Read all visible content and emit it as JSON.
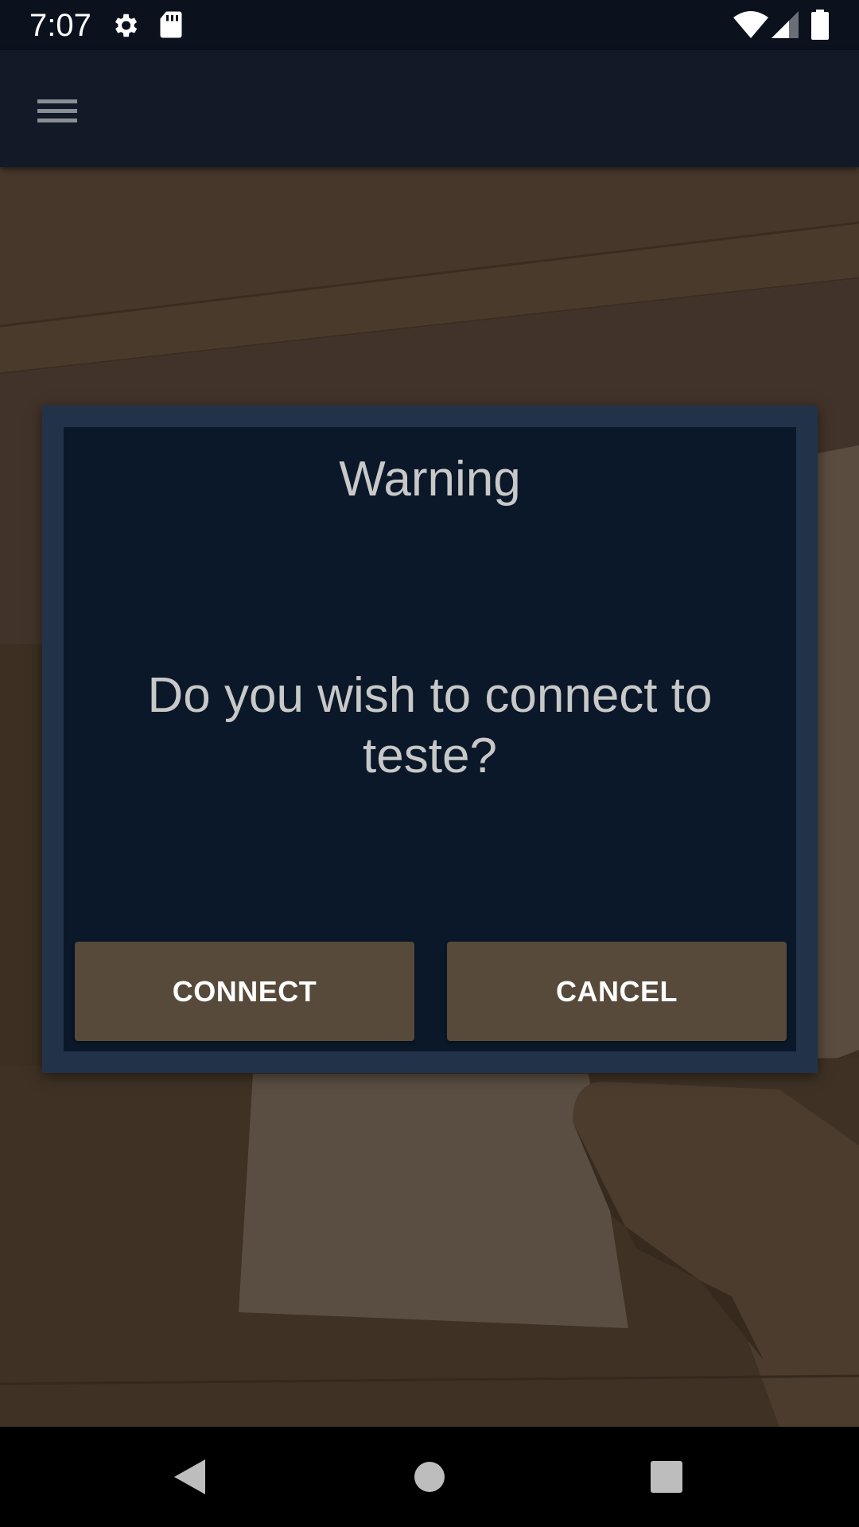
{
  "status_bar": {
    "time": "7:07",
    "icons": [
      "settings-icon",
      "sd-card-icon",
      "wifi-icon",
      "signal-icon",
      "battery-icon"
    ]
  },
  "app_bar": {
    "menu_icon": "hamburger-menu-icon"
  },
  "dialog": {
    "title": "Warning",
    "message": "Do you wish to connect to teste?",
    "connect_label": "CONNECT",
    "cancel_label": "CANCEL"
  },
  "nav_bar": {
    "icons": [
      "back-icon",
      "home-icon",
      "recents-icon"
    ]
  },
  "colors": {
    "status_bar_bg": "#0b121d",
    "app_bar_bg": "#121a27",
    "dialog_frame": "#223248",
    "dialog_bg": "#0a1829",
    "button_bg": "#574a3b",
    "text_gray": "#c8c8c8"
  }
}
